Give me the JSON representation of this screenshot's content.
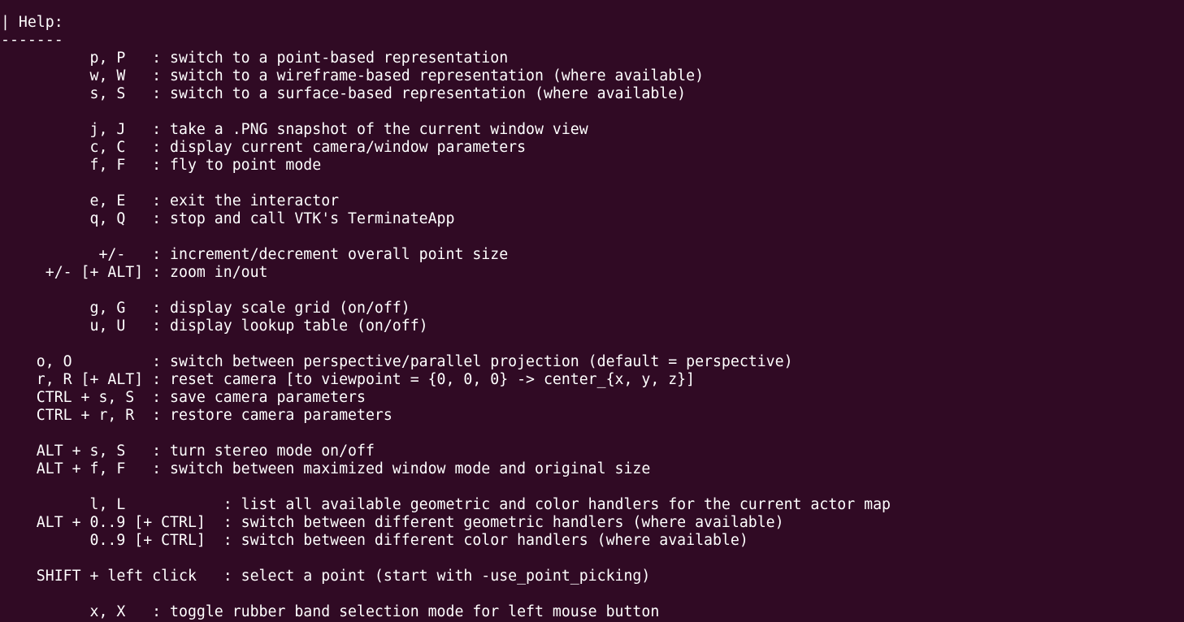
{
  "terminal": {
    "background": "#300a24",
    "foreground": "#ffffff",
    "lines": [
      "| Help:",
      "-------",
      "          p, P   : switch to a point-based representation",
      "          w, W   : switch to a wireframe-based representation (where available)",
      "          s, S   : switch to a surface-based representation (where available)",
      "",
      "          j, J   : take a .PNG snapshot of the current window view",
      "          c, C   : display current camera/window parameters",
      "          f, F   : fly to point mode",
      "",
      "          e, E   : exit the interactor",
      "          q, Q   : stop and call VTK's TerminateApp",
      "",
      "           +/-   : increment/decrement overall point size",
      "     +/- [+ ALT] : zoom in/out",
      "",
      "          g, G   : display scale grid (on/off)",
      "          u, U   : display lookup table (on/off)",
      "",
      "    o, O         : switch between perspective/parallel projection (default = perspective)",
      "    r, R [+ ALT] : reset camera [to viewpoint = {0, 0, 0} -> center_{x, y, z}]",
      "    CTRL + s, S  : save camera parameters",
      "    CTRL + r, R  : restore camera parameters",
      "",
      "    ALT + s, S   : turn stereo mode on/off",
      "    ALT + f, F   : switch between maximized window mode and original size",
      "",
      "          l, L           : list all available geometric and color handlers for the current actor map",
      "    ALT + 0..9 [+ CTRL]  : switch between different geometric handlers (where available)",
      "          0..9 [+ CTRL]  : switch between different color handlers (where available)",
      "",
      "    SHIFT + left click   : select a point (start with -use_point_picking)",
      "",
      "          x, X   : toggle rubber band selection mode for left mouse button"
    ]
  }
}
